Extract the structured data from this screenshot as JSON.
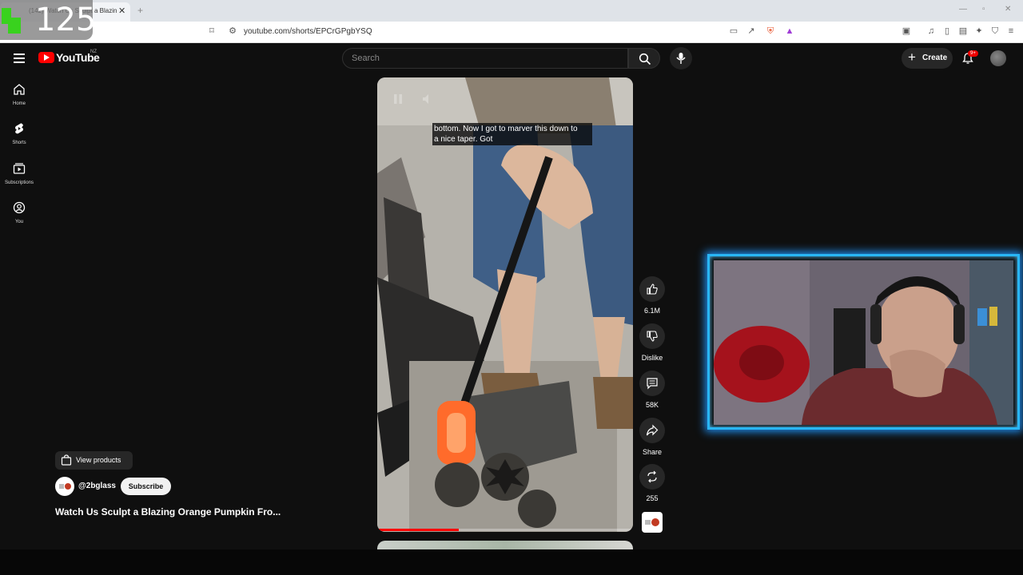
{
  "browser": {
    "tab_title": "(142) Watch Us Sculpt a Blazing",
    "url": "youtube.com/shorts/EPCrGPgbYSQ"
  },
  "overlay": {
    "counter": "125"
  },
  "header": {
    "logo_text": "YouTube",
    "country_code": "NZ",
    "search_placeholder": "Search",
    "create_label": "Create",
    "notification_count": "9+"
  },
  "sidebar": {
    "items": [
      {
        "label": "Home",
        "icon": "home-icon"
      },
      {
        "label": "Shorts",
        "icon": "shorts-icon"
      },
      {
        "label": "Subscriptions",
        "icon": "subscriptions-icon"
      },
      {
        "label": "You",
        "icon": "you-icon"
      }
    ]
  },
  "short": {
    "caption_line1": "bottom. Now I got to marver this down to",
    "caption_line2": "a nice taper. Got",
    "progress": 0.32,
    "view_products_label": "View products",
    "channel_handle": "@2bglass",
    "subscribe_label": "Subscribe",
    "title": "Watch Us Sculpt a Blazing Orange Pumpkin Fro..."
  },
  "actions": {
    "like_count": "6.1M",
    "dislike_label": "Dislike",
    "comment_count": "58K",
    "share_label": "Share",
    "remix_count": "255"
  },
  "colors": {
    "background": "#0f0f0f",
    "brand_red": "#ff0000",
    "webcam_glow": "#29b6f6"
  }
}
